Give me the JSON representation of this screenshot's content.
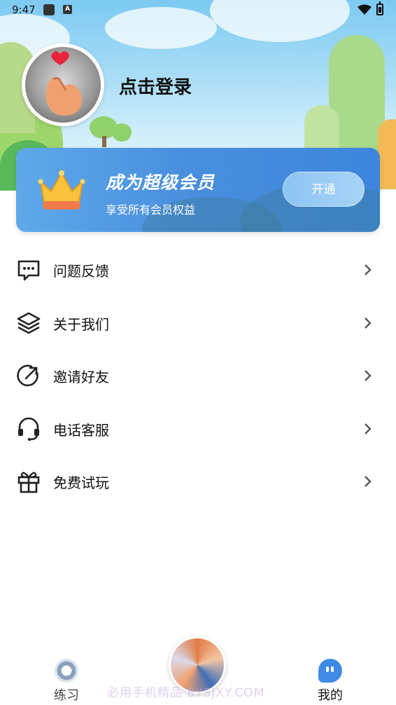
{
  "status_bar": {
    "time": "9:47",
    "badge_letter": "A"
  },
  "profile": {
    "login_label": "点击登录"
  },
  "vip": {
    "title": "成为超级会员",
    "subtitle": "享受所有会员权益",
    "button_label": "开通"
  },
  "menu": {
    "items": [
      {
        "label": "问题反馈",
        "icon": "chat-bubble-icon"
      },
      {
        "label": "关于我们",
        "icon": "layers-icon"
      },
      {
        "label": "邀请好友",
        "icon": "share-arrow-icon"
      },
      {
        "label": "电话客服",
        "icon": "headset-icon"
      },
      {
        "label": "免费试玩",
        "icon": "gift-icon"
      }
    ]
  },
  "nav": {
    "practice_label": "练习",
    "mine_label": "我的"
  },
  "watermark": "必用手机精品 BYSJXY.COM",
  "colors": {
    "accent": "#3f8be6",
    "vip_banner": "#4a8fde"
  }
}
